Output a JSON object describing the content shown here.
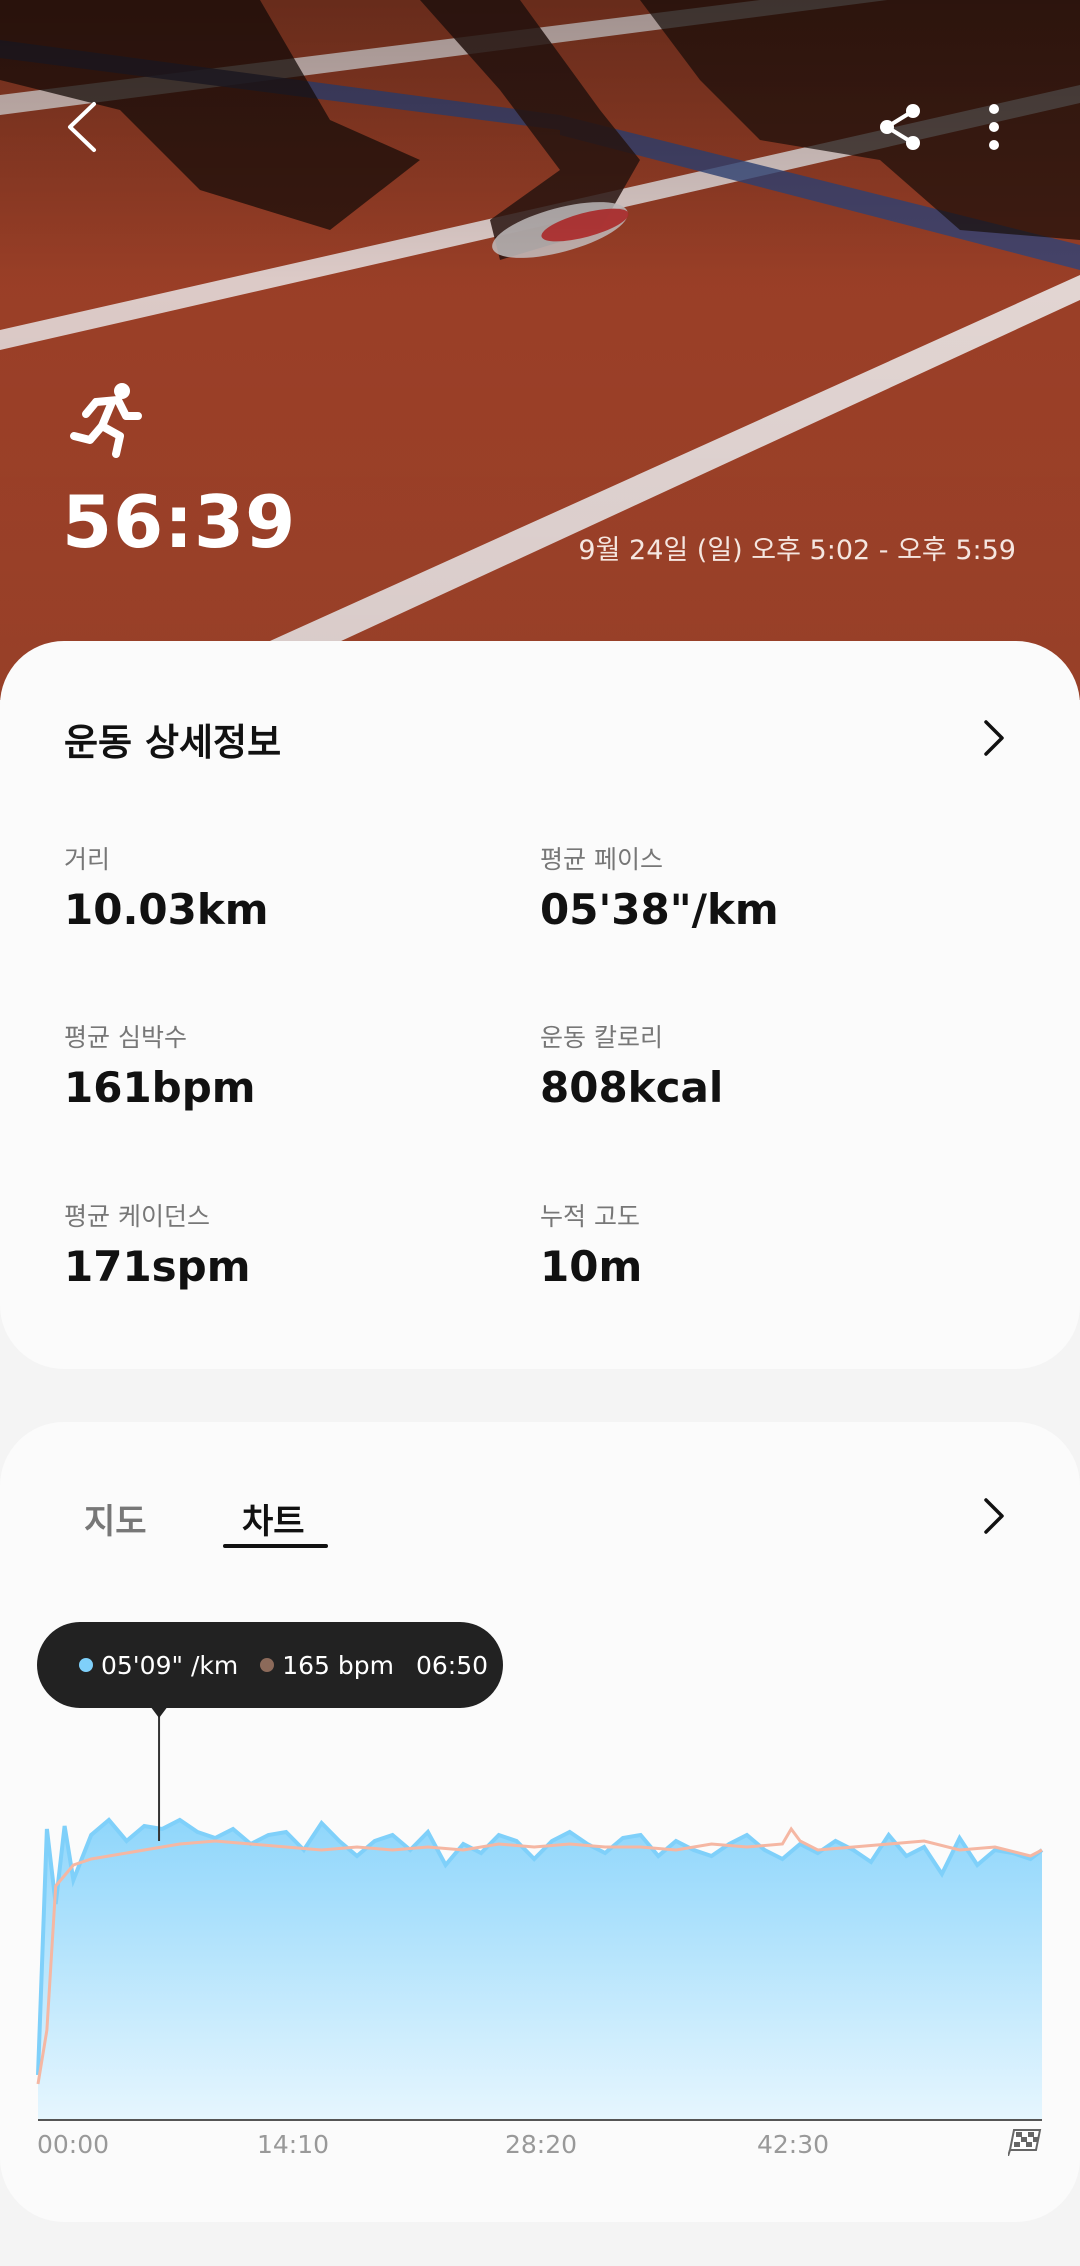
{
  "header": {
    "back_icon": "chevron-left-icon",
    "share_icon": "share-icon",
    "more_icon": "more-vert-icon",
    "activity_icon": "running-icon",
    "duration": "56:39",
    "date_range": "9월 24일 (일) 오후 5:02 - 오후 5:59"
  },
  "details": {
    "title": "운동 상세정보",
    "stats": [
      {
        "label": "거리",
        "value": "10.03km"
      },
      {
        "label": "평균 페이스",
        "value": "05'38\"/km"
      },
      {
        "label": "평균 심박수",
        "value": "161bpm"
      },
      {
        "label": "운동 칼로리",
        "value": "808kcal"
      },
      {
        "label": "평균 케이던스",
        "value": "171spm"
      },
      {
        "label": "누적 고도",
        "value": "10m"
      }
    ]
  },
  "chart_section": {
    "tabs": [
      {
        "label": "지도",
        "selected": false
      },
      {
        "label": "차트",
        "selected": true
      }
    ],
    "tooltip": {
      "pace": "05'09\" /km",
      "heart_rate": "165 bpm",
      "time": "06:50",
      "pace_color": "#7fd0fa",
      "hr_color": "#8c6a5a"
    },
    "finish_icon": "checkered-flag-icon"
  },
  "chart_data": {
    "type": "area",
    "x_ticks": [
      "00:00",
      "14:10",
      "28:20",
      "42:30"
    ],
    "x_range_minutes": [
      0,
      56.65
    ],
    "series": [
      {
        "name": "pace",
        "color": "#7fd0fa",
        "x": [
          0,
          0.5,
          1,
          1.5,
          2,
          3,
          4,
          5,
          6,
          7,
          8,
          9,
          10,
          11,
          12,
          13,
          14,
          15,
          16,
          17,
          18,
          19,
          20,
          21,
          22,
          23,
          24,
          25,
          26,
          27,
          28,
          29,
          30,
          31,
          32,
          33,
          34,
          35,
          36,
          37,
          38,
          39,
          40,
          41,
          42,
          43,
          44,
          45,
          46,
          47,
          48,
          49,
          50,
          51,
          52,
          53,
          54,
          55,
          56,
          56.65
        ],
        "y": [
          0.15,
          0.97,
          0.72,
          0.98,
          0.8,
          0.95,
          1.0,
          0.93,
          0.98,
          0.97,
          1.0,
          0.96,
          0.94,
          0.97,
          0.92,
          0.95,
          0.96,
          0.9,
          0.99,
          0.93,
          0.88,
          0.93,
          0.95,
          0.9,
          0.96,
          0.85,
          0.92,
          0.89,
          0.95,
          0.93,
          0.87,
          0.93,
          0.96,
          0.92,
          0.89,
          0.94,
          0.95,
          0.88,
          0.93,
          0.9,
          0.88,
          0.92,
          0.95,
          0.9,
          0.87,
          0.92,
          0.89,
          0.93,
          0.9,
          0.86,
          0.95,
          0.88,
          0.91,
          0.82,
          0.94,
          0.85,
          0.9,
          0.89,
          0.87,
          0.9
        ]
      },
      {
        "name": "heart_rate",
        "color": "#f5b7a3",
        "x": [
          0,
          0.5,
          1,
          2,
          3,
          4,
          6,
          8,
          10,
          12,
          14,
          16,
          18,
          20,
          22,
          24,
          26,
          28,
          30,
          32,
          34,
          36,
          38,
          40,
          42,
          42.5,
          43,
          44,
          46,
          48,
          50,
          52,
          54,
          56,
          56.65
        ],
        "y": [
          0.12,
          0.3,
          0.78,
          0.85,
          0.87,
          0.88,
          0.9,
          0.92,
          0.93,
          0.92,
          0.91,
          0.9,
          0.91,
          0.9,
          0.91,
          0.9,
          0.92,
          0.91,
          0.92,
          0.91,
          0.91,
          0.9,
          0.92,
          0.91,
          0.92,
          0.97,
          0.93,
          0.9,
          0.91,
          0.92,
          0.93,
          0.9,
          0.91,
          0.88,
          0.9
        ]
      }
    ],
    "cursor_x_minutes": 6.83
  }
}
